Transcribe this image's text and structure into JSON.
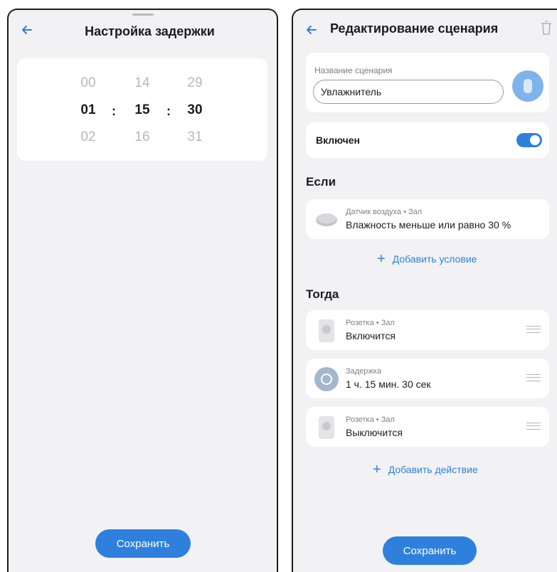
{
  "delay_screen": {
    "title": "Настройка задержки",
    "picker": {
      "hours": [
        "00",
        "01",
        "02"
      ],
      "minutes": [
        "14",
        "15",
        "16"
      ],
      "seconds": [
        "29",
        "30",
        "31"
      ],
      "separator": ":"
    },
    "save_label": "Сохранить"
  },
  "edit_screen": {
    "title": "Редактирование сценария",
    "name_label": "Название сценария",
    "name_value": "Увлажнитель",
    "enabled_label": "Включен",
    "enabled": true,
    "if_title": "Если",
    "conditions": [
      {
        "sub": "Датчик воздуха • Зал",
        "main": "Влажность меньше или равно 30 %",
        "icon": "air-sensor-icon"
      }
    ],
    "add_condition_label": "Добавить условие",
    "then_title": "Тогда",
    "actions": [
      {
        "sub": "Розетка • Зал",
        "main": "Включится",
        "icon": "socket-icon"
      },
      {
        "sub": "Задержка",
        "main": "1 ч. 15 мин. 30 сек",
        "icon": "timer-icon"
      },
      {
        "sub": "Розетка • Зал",
        "main": "Выключится",
        "icon": "socket-icon"
      }
    ],
    "add_action_label": "Добавить действие",
    "save_label": "Сохранить"
  },
  "colors": {
    "accent": "#2f80dd",
    "background": "#f2f2f4",
    "card": "#ffffff"
  }
}
